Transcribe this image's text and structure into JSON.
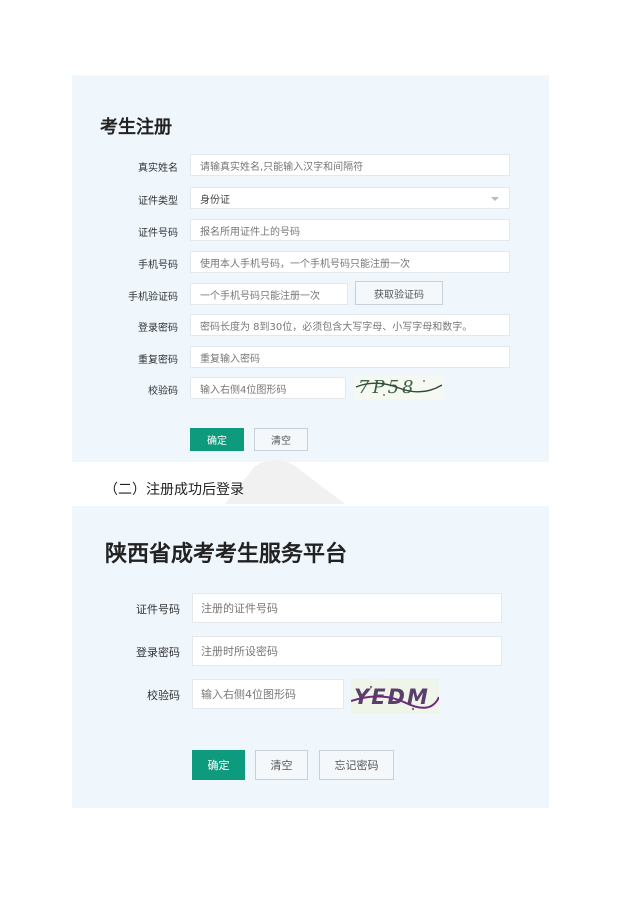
{
  "registration": {
    "title": "考生注册",
    "fields": [
      {
        "label": "真实姓名",
        "placeholder": "请输真实姓名,只能输入汉字和间隔符"
      },
      {
        "label": "证件类型",
        "value": "身份证"
      },
      {
        "label": "证件号码",
        "placeholder": "报名所用证件上的号码"
      },
      {
        "label": "手机号码",
        "placeholder": "使用本人手机号码，一个手机号码只能注册一次"
      },
      {
        "label": "手机验证码",
        "placeholder": "一个手机号码只能注册一次"
      },
      {
        "label": "登录密码",
        "placeholder": "密码长度为 8到30位，必须包含大写字母、小写字母和数字。"
      },
      {
        "label": "重复密码",
        "placeholder": "重复输入密码"
      },
      {
        "label": "校验码",
        "placeholder": "输入右侧4位图形码"
      }
    ],
    "get_code_button": "获取验证码",
    "captcha_text": "7P58",
    "confirm_button": "确定",
    "clear_button": "清空"
  },
  "caption": "（二）注册成功后登录",
  "login": {
    "title": "陕西省成考考生服务平台",
    "fields": [
      {
        "label": "证件号码",
        "placeholder": "注册的证件号码"
      },
      {
        "label": "登录密码",
        "placeholder": "注册时所设密码"
      },
      {
        "label": "校验码",
        "placeholder": "输入右侧4位图形码"
      }
    ],
    "captcha_text": "YEDM",
    "confirm_button": "确定",
    "clear_button": "清空",
    "forgot_button": "忘记密码"
  },
  "colors": {
    "panel_bg": "#eff7fd",
    "primary": "#0e9a7c",
    "border": "#e3e8ed"
  }
}
